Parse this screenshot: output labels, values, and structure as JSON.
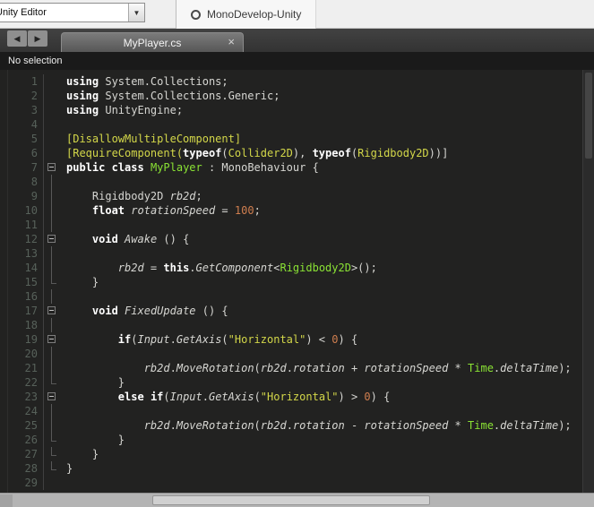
{
  "colors": {
    "editor_bg": "#222221",
    "keyword": "#ffffff",
    "plain_text": "#d6d6d2",
    "type_green": "#8ae234",
    "attribute_yellow": "#d3d749",
    "string_yellow": "#d3d749",
    "number_orange": "#cf7e4f",
    "line_number": "#57615a"
  },
  "topbar": {
    "target_selector": {
      "value": "Unity Editor",
      "dropdown_icon": "▼"
    },
    "app_tab": {
      "label": "MonoDevelop-Unity"
    }
  },
  "tabbar": {
    "back_label": "◀",
    "forward_label": "▶",
    "tab": {
      "label": "MyPlayer.cs",
      "close_label": "×"
    }
  },
  "statusbar": {
    "text": "No selection"
  },
  "editor": {
    "lines": [
      {
        "n": 1,
        "fold": "",
        "t": [
          [
            "kw",
            "using"
          ],
          [
            "pl",
            " System.Collections;"
          ]
        ]
      },
      {
        "n": 2,
        "fold": "",
        "t": [
          [
            "kw",
            "using"
          ],
          [
            "pl",
            " System.Collections.Generic;"
          ]
        ]
      },
      {
        "n": 3,
        "fold": "",
        "t": [
          [
            "kw",
            "using"
          ],
          [
            "pl",
            " UnityEngine;"
          ]
        ]
      },
      {
        "n": 4,
        "fold": "",
        "t": []
      },
      {
        "n": 5,
        "fold": "",
        "t": [
          [
            "at",
            "[DisallowMultipleComponent]"
          ]
        ]
      },
      {
        "n": 6,
        "fold": "",
        "t": [
          [
            "at",
            "[RequireComponent("
          ],
          [
            "kw",
            "typeof"
          ],
          [
            "pl",
            "("
          ],
          [
            "at",
            "Collider2D"
          ],
          [
            "pl",
            "), "
          ],
          [
            "kw",
            "typeof"
          ],
          [
            "pl",
            "("
          ],
          [
            "at",
            "Rigidbody2D"
          ],
          [
            "pl",
            "))]"
          ]
        ]
      },
      {
        "n": 7,
        "fold": "box",
        "t": [
          [
            "kw",
            "public"
          ],
          [
            "pl",
            " "
          ],
          [
            "kw",
            "class"
          ],
          [
            "pl",
            " "
          ],
          [
            "ty",
            "MyPlayer"
          ],
          [
            "pl",
            " : MonoBehaviour {"
          ]
        ]
      },
      {
        "n": 8,
        "fold": "v",
        "t": []
      },
      {
        "n": 9,
        "fold": "v",
        "t": [
          [
            "pl",
            "    Rigidbody2D "
          ],
          [
            "id",
            "rb2d"
          ],
          [
            "pl",
            ";"
          ]
        ]
      },
      {
        "n": 10,
        "fold": "v",
        "t": [
          [
            "pl",
            "    "
          ],
          [
            "kw",
            "float"
          ],
          [
            "pl",
            " "
          ],
          [
            "id",
            "rotationSpeed"
          ],
          [
            "pl",
            " = "
          ],
          [
            "nu",
            "100"
          ],
          [
            "pl",
            ";"
          ]
        ]
      },
      {
        "n": 11,
        "fold": "v",
        "t": []
      },
      {
        "n": 12,
        "fold": "box",
        "t": [
          [
            "pl",
            "    "
          ],
          [
            "kw",
            "void"
          ],
          [
            "pl",
            " "
          ],
          [
            "id",
            "Awake"
          ],
          [
            "pl",
            " () {"
          ]
        ]
      },
      {
        "n": 13,
        "fold": "v",
        "t": []
      },
      {
        "n": 14,
        "fold": "v",
        "t": [
          [
            "pl",
            "        "
          ],
          [
            "id",
            "rb2d"
          ],
          [
            "pl",
            " = "
          ],
          [
            "kw",
            "this"
          ],
          [
            "pl",
            "."
          ],
          [
            "id",
            "GetComponent"
          ],
          [
            "pl",
            "<"
          ],
          [
            "ty",
            "Rigidbody2D"
          ],
          [
            "pl",
            ">();"
          ]
        ]
      },
      {
        "n": 15,
        "fold": "end",
        "t": [
          [
            "pl",
            "    }"
          ]
        ]
      },
      {
        "n": 16,
        "fold": "v",
        "t": []
      },
      {
        "n": 17,
        "fold": "box",
        "t": [
          [
            "pl",
            "    "
          ],
          [
            "kw",
            "void"
          ],
          [
            "pl",
            " "
          ],
          [
            "id",
            "FixedUpdate"
          ],
          [
            "pl",
            " () {"
          ]
        ]
      },
      {
        "n": 18,
        "fold": "v",
        "t": []
      },
      {
        "n": 19,
        "fold": "box",
        "t": [
          [
            "pl",
            "        "
          ],
          [
            "kw",
            "if"
          ],
          [
            "pl",
            "("
          ],
          [
            "id",
            "Input"
          ],
          [
            "pl",
            "."
          ],
          [
            "id",
            "GetAxis"
          ],
          [
            "pl",
            "("
          ],
          [
            "st",
            "\"Horizontal\""
          ],
          [
            "pl",
            ") < "
          ],
          [
            "nu",
            "0"
          ],
          [
            "pl",
            ") {"
          ]
        ]
      },
      {
        "n": 20,
        "fold": "v",
        "t": []
      },
      {
        "n": 21,
        "fold": "v",
        "t": [
          [
            "pl",
            "            "
          ],
          [
            "id",
            "rb2d"
          ],
          [
            "pl",
            "."
          ],
          [
            "id",
            "MoveRotation"
          ],
          [
            "pl",
            "("
          ],
          [
            "id",
            "rb2d"
          ],
          [
            "pl",
            "."
          ],
          [
            "id",
            "rotation"
          ],
          [
            "pl",
            " + "
          ],
          [
            "id",
            "rotationSpeed"
          ],
          [
            "pl",
            " * "
          ],
          [
            "ty",
            "Time"
          ],
          [
            "pl",
            "."
          ],
          [
            "id",
            "deltaTime"
          ],
          [
            "pl",
            ");"
          ]
        ]
      },
      {
        "n": 22,
        "fold": "end",
        "t": [
          [
            "pl",
            "        }"
          ]
        ]
      },
      {
        "n": 23,
        "fold": "box",
        "t": [
          [
            "pl",
            "        "
          ],
          [
            "kw",
            "else"
          ],
          [
            "pl",
            " "
          ],
          [
            "kw",
            "if"
          ],
          [
            "pl",
            "("
          ],
          [
            "id",
            "Input"
          ],
          [
            "pl",
            "."
          ],
          [
            "id",
            "GetAxis"
          ],
          [
            "pl",
            "("
          ],
          [
            "st",
            "\"Horizontal\""
          ],
          [
            "pl",
            ") > "
          ],
          [
            "nu",
            "0"
          ],
          [
            "pl",
            ") {"
          ]
        ]
      },
      {
        "n": 24,
        "fold": "v",
        "t": []
      },
      {
        "n": 25,
        "fold": "v",
        "t": [
          [
            "pl",
            "            "
          ],
          [
            "id",
            "rb2d"
          ],
          [
            "pl",
            "."
          ],
          [
            "id",
            "MoveRotation"
          ],
          [
            "pl",
            "("
          ],
          [
            "id",
            "rb2d"
          ],
          [
            "pl",
            "."
          ],
          [
            "id",
            "rotation"
          ],
          [
            "pl",
            " - "
          ],
          [
            "id",
            "rotationSpeed"
          ],
          [
            "pl",
            " * "
          ],
          [
            "ty",
            "Time"
          ],
          [
            "pl",
            "."
          ],
          [
            "id",
            "deltaTime"
          ],
          [
            "pl",
            ");"
          ]
        ]
      },
      {
        "n": 26,
        "fold": "end",
        "t": [
          [
            "pl",
            "        }"
          ]
        ]
      },
      {
        "n": 27,
        "fold": "end",
        "t": [
          [
            "pl",
            "    }"
          ]
        ]
      },
      {
        "n": 28,
        "fold": "end",
        "t": [
          [
            "pl",
            "}"
          ]
        ]
      },
      {
        "n": 29,
        "fold": "",
        "t": []
      }
    ]
  }
}
